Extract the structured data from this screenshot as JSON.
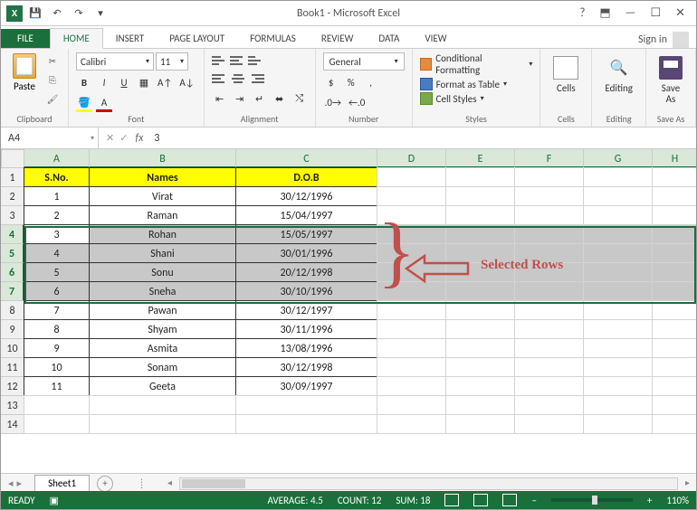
{
  "titlebar": {
    "title": "Book1 - Microsoft Excel"
  },
  "ribbon_tabs": {
    "file": "FILE",
    "home": "HOME",
    "insert": "INSERT",
    "page_layout": "PAGE LAYOUT",
    "formulas": "FORMULAS",
    "review": "REVIEW",
    "data": "DATA",
    "view": "VIEW",
    "sign_in": "Sign in"
  },
  "ribbon": {
    "clipboard": {
      "paste": "Paste",
      "label": "Clipboard"
    },
    "font": {
      "name": "Calibri",
      "size": "11",
      "label": "Font"
    },
    "alignment": {
      "label": "Alignment"
    },
    "number": {
      "format": "General",
      "label": "Number"
    },
    "styles": {
      "cond_fmt": "Conditional Formatting",
      "fmt_table": "Format as Table",
      "cell_styles": "Cell Styles",
      "label": "Styles"
    },
    "cells": {
      "label": "Cells",
      "text": "Cells"
    },
    "editing": {
      "label": "Editing",
      "text": "Editing"
    },
    "save_as": {
      "text1": "Save",
      "text2": "As",
      "label": "Save As"
    }
  },
  "formula_bar": {
    "name_box": "A4",
    "formula": "3"
  },
  "columns": [
    "A",
    "B",
    "C",
    "D",
    "E",
    "F",
    "G",
    "H"
  ],
  "header_row": {
    "sno": "S.No.",
    "names": "Names",
    "dob": "D.O.B"
  },
  "rows": [
    {
      "r": 2,
      "sno": "1",
      "name": "Virat",
      "dob": "30/12/1996"
    },
    {
      "r": 3,
      "sno": "2",
      "name": "Raman",
      "dob": "15/04/1997"
    },
    {
      "r": 4,
      "sno": "3",
      "name": "Rohan",
      "dob": "15/05/1997",
      "selected": true,
      "active": true
    },
    {
      "r": 5,
      "sno": "4",
      "name": "Shani",
      "dob": "30/01/1996",
      "selected": true
    },
    {
      "r": 6,
      "sno": "5",
      "name": "Sonu",
      "dob": "20/12/1998",
      "selected": true
    },
    {
      "r": 7,
      "sno": "6",
      "name": "Sneha",
      "dob": "30/10/1996",
      "selected": true
    },
    {
      "r": 8,
      "sno": "7",
      "name": "Pawan",
      "dob": "30/12/1997"
    },
    {
      "r": 9,
      "sno": "8",
      "name": "Shyam",
      "dob": "30/11/1996"
    },
    {
      "r": 10,
      "sno": "9",
      "name": "Asmita",
      "dob": "13/08/1996"
    },
    {
      "r": 11,
      "sno": "10",
      "name": "Sonam",
      "dob": "30/12/1998"
    },
    {
      "r": 12,
      "sno": "11",
      "name": "Geeta",
      "dob": "30/09/1997"
    }
  ],
  "empty_rows": [
    13,
    14
  ],
  "annotation": {
    "text": "Selected Rows"
  },
  "sheet_tabs": {
    "sheet1": "Sheet1"
  },
  "status_bar": {
    "ready": "READY",
    "average": "AVERAGE: 4.5",
    "count": "COUNT: 12",
    "sum": "SUM: 18",
    "zoom": "110%"
  }
}
